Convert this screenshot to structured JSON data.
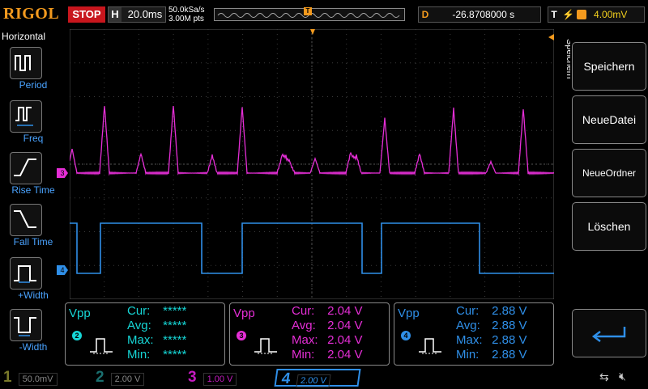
{
  "top": {
    "logo": "RIGOL",
    "run_state": "STOP",
    "horizontal_key": "H",
    "timebase": "20.0ms",
    "sample_rate": "50.0kSa/s",
    "memory_depth": "3.00M pts",
    "trigger_marker": "T",
    "delay_key": "D",
    "delay_value": "-26.8708000 s",
    "trigger_key": "T",
    "trigger_level": "4.00mV"
  },
  "left_panel": {
    "title": "Horizontal",
    "buttons": [
      {
        "label": "Period",
        "icon": "period-icon"
      },
      {
        "label": "Freq",
        "icon": "frequency-icon"
      },
      {
        "label": "Rise Time",
        "icon": "rise-time-icon"
      },
      {
        "label": "Fall Time",
        "icon": "fall-time-icon"
      },
      {
        "label": "+Width",
        "icon": "positive-width-icon"
      },
      {
        "label": "-Width",
        "icon": "negative-width-icon"
      }
    ]
  },
  "right_panel": {
    "menu_title": "Speichern",
    "buttons": [
      "Speichern",
      "NeueDatei",
      "NeueOrdner",
      "Löschen"
    ],
    "enter_icon": "enter-arrow-icon"
  },
  "waveform_markers": {
    "ch3": "3",
    "ch4": "4"
  },
  "measurements": [
    {
      "label": "Vpp",
      "channel": "2",
      "color": "#16d6d6",
      "cur_key": "Cur:",
      "cur": "*****",
      "avg_key": "Avg:",
      "avg": "*****",
      "max_key": "Max:",
      "max": "*****",
      "min_key": "Min:",
      "min": "*****"
    },
    {
      "label": "Vpp",
      "channel": "3",
      "color": "#e52ed6",
      "cur_key": "Cur:",
      "cur": "2.04 V",
      "avg_key": "Avg:",
      "avg": "2.04 V",
      "max_key": "Max:",
      "max": "2.04 V",
      "min_key": "Min:",
      "min": "2.04 V"
    },
    {
      "label": "Vpp",
      "channel": "4",
      "color": "#2f8fe8",
      "cur_key": "Cur:",
      "cur": "2.88 V",
      "avg_key": "Avg:",
      "avg": "2.88 V",
      "max_key": "Max:",
      "max": "2.88 V",
      "min_key": "Min:",
      "min": "2.88 V"
    }
  ],
  "channels": [
    {
      "num": "1",
      "scale": "50.0mV",
      "color": "#7a7a2a"
    },
    {
      "num": "2",
      "scale": "2.00 V",
      "color": "#1a6f6f"
    },
    {
      "num": "3",
      "scale": "1.00 V",
      "color": "#c51bc0"
    },
    {
      "num": "4",
      "scale": "2.00 V",
      "color": "#2f8fe8"
    }
  ],
  "colors": {
    "accent": "#f39a1e",
    "stop": "#c8161d",
    "ch3": "#e52ed6",
    "ch4": "#2f8fe8",
    "grid": "#3a3a3a"
  }
}
